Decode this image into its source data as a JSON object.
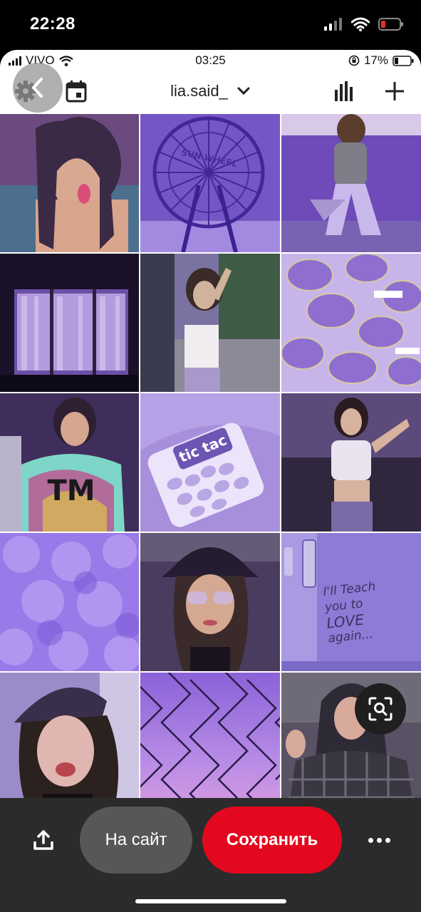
{
  "device_status": {
    "time": "22:28",
    "icons": [
      "signal-icon",
      "wifi-icon",
      "battery-low-icon"
    ],
    "battery_color": "#e5312f"
  },
  "inner_status": {
    "carrier": "VIVO",
    "time": "03:25",
    "battery": "17%",
    "icons": [
      "signal-icon",
      "wifi-icon",
      "rotation-lock-icon",
      "battery-icon"
    ]
  },
  "profile_header": {
    "username": "lia.said_",
    "icons": [
      "back-icon",
      "settings-gear-icon",
      "calendar-icon",
      "chevron-down-icon",
      "analytics-icon",
      "plus-icon"
    ]
  },
  "grid": {
    "tiles": [
      {
        "subject": "selfie-tongue",
        "palette": [
          "#6b4a7f",
          "#d8a890",
          "#3a2a45"
        ]
      },
      {
        "subject": "ferris-wheel",
        "palette": [
          "#7656c4",
          "#5a3aa8",
          "#a38ae0"
        ],
        "sign_text": "SUN WHEEL"
      },
      {
        "subject": "girl-on-bench",
        "palette": [
          "#6e4bb8",
          "#a896cf",
          "#d8c9e8"
        ]
      },
      {
        "subject": "window-curtains",
        "palette": [
          "#1a1228",
          "#6d4fa6",
          "#c9b6e8"
        ]
      },
      {
        "subject": "street-pose",
        "palette": [
          "#7a72a0",
          "#d0b39c",
          "#3b3b4f"
        ]
      },
      {
        "subject": "purple-sunglasses",
        "palette": [
          "#8e6fd0",
          "#c7b5ea",
          "#5b3ea3"
        ]
      },
      {
        "subject": "tie-dye-shirt",
        "palette": [
          "#3f2e5b",
          "#c93f85",
          "#7ed6c8"
        ],
        "shirt_text": "TM"
      },
      {
        "subject": "tic-tac-box",
        "palette": [
          "#a78fdb",
          "#ece4fa",
          "#6d55b4"
        ],
        "brand_text": "tic tac"
      },
      {
        "subject": "crop-top-pose",
        "palette": [
          "#5c4a7a",
          "#e9e3ef",
          "#30273f"
        ]
      },
      {
        "subject": "purple-balloons",
        "palette": [
          "#9a79e8",
          "#b79bf2",
          "#7a57d6"
        ]
      },
      {
        "subject": "bucket-hat-selfie",
        "palette": [
          "#4a3c5e",
          "#d4a891",
          "#251c31"
        ]
      },
      {
        "subject": "wall-writing",
        "palette": [
          "#8d7bd6",
          "#a99ae3",
          "#3c3260"
        ],
        "writing": [
          "I'll Teach",
          "you to",
          "LOVE",
          "again..."
        ]
      },
      {
        "subject": "cap-selfie",
        "palette": [
          "#9b8cc9",
          "#e0b7b0",
          "#3a2f4a"
        ]
      },
      {
        "subject": "chain-fence-sky",
        "palette": [
          "#8a62d8",
          "#d79be0",
          "#2a1c49"
        ]
      },
      {
        "subject": "plaid-shirt",
        "palette": [
          "#595264",
          "#d7aa9b",
          "#2e2a36"
        ]
      }
    ]
  },
  "action_bar": {
    "visit_label": "На сайт",
    "save_label": "Сохранить",
    "save_color": "#e3081f",
    "icons": [
      "share-icon",
      "more-icon",
      "visual-search-icon"
    ]
  }
}
